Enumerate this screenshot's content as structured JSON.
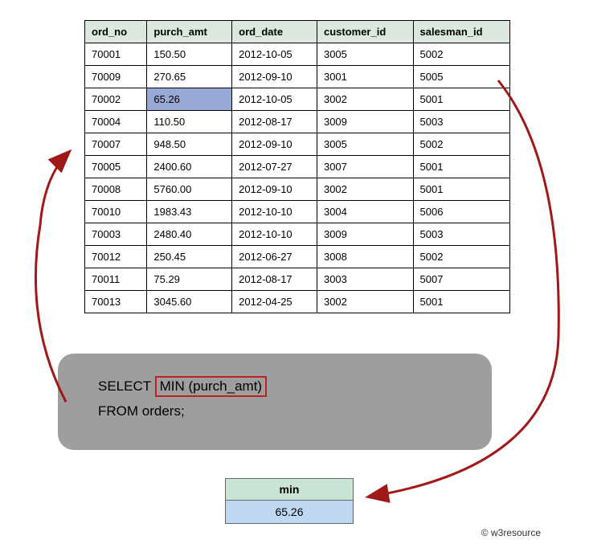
{
  "table": {
    "headers": [
      "ord_no",
      "purch_amt",
      "ord_date",
      "customer_id",
      "salesman_id"
    ],
    "rows": [
      {
        "ord_no": "70001",
        "purch_amt": "150.50",
        "ord_date": "2012-10-05",
        "customer_id": "3005",
        "salesman_id": "5002",
        "highlight_col": null
      },
      {
        "ord_no": "70009",
        "purch_amt": "270.65",
        "ord_date": "2012-09-10",
        "customer_id": "3001",
        "salesman_id": "5005",
        "highlight_col": null
      },
      {
        "ord_no": "70002",
        "purch_amt": "65.26",
        "ord_date": "2012-10-05",
        "customer_id": "3002",
        "salesman_id": "5001",
        "highlight_col": "purch_amt"
      },
      {
        "ord_no": "70004",
        "purch_amt": "110.50",
        "ord_date": "2012-08-17",
        "customer_id": "3009",
        "salesman_id": "5003",
        "highlight_col": null
      },
      {
        "ord_no": "70007",
        "purch_amt": "948.50",
        "ord_date": "2012-09-10",
        "customer_id": "3005",
        "salesman_id": "5002",
        "highlight_col": null
      },
      {
        "ord_no": "70005",
        "purch_amt": "2400.60",
        "ord_date": "2012-07-27",
        "customer_id": "3007",
        "salesman_id": "5001",
        "highlight_col": null
      },
      {
        "ord_no": "70008",
        "purch_amt": "5760.00",
        "ord_date": "2012-09-10",
        "customer_id": "3002",
        "salesman_id": "5001",
        "highlight_col": null
      },
      {
        "ord_no": "70010",
        "purch_amt": "1983.43",
        "ord_date": "2012-10-10",
        "customer_id": "3004",
        "salesman_id": "5006",
        "highlight_col": null
      },
      {
        "ord_no": "70003",
        "purch_amt": "2480.40",
        "ord_date": "2012-10-10",
        "customer_id": "3009",
        "salesman_id": "5003",
        "highlight_col": null
      },
      {
        "ord_no": "70012",
        "purch_amt": "250.45",
        "ord_date": "2012-06-27",
        "customer_id": "3008",
        "salesman_id": "5002",
        "highlight_col": null
      },
      {
        "ord_no": "70011",
        "purch_amt": "75.29",
        "ord_date": "2012-08-17",
        "customer_id": "3003",
        "salesman_id": "5007",
        "highlight_col": null
      },
      {
        "ord_no": "70013",
        "purch_amt": "3045.60",
        "ord_date": "2012-04-25",
        "customer_id": "3002",
        "salesman_id": "5001",
        "highlight_col": null
      }
    ]
  },
  "sql": {
    "select_kw": "SELECT",
    "aggregate": "MIN (purch_amt)",
    "from_line": "FROM orders;"
  },
  "result": {
    "header": "min",
    "value": "65.26"
  },
  "credit": "© w3resource"
}
